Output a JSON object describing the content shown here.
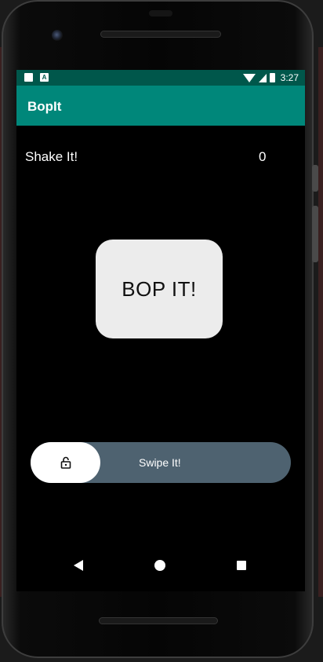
{
  "status_bar": {
    "time": "3:27",
    "icons": [
      "sd-card-icon",
      "a-notification-icon",
      "wifi-icon",
      "signal-icon",
      "battery-icon"
    ],
    "notification_a_letter": "A"
  },
  "app_bar": {
    "title": "BopIt",
    "color": "#00877a"
  },
  "game": {
    "instruction": "Shake It!",
    "score": "0"
  },
  "bop_button": {
    "label": "BOP IT!"
  },
  "swipe": {
    "label": "Swipe It!",
    "thumb_icon": "lock-icon",
    "track_color": "#4e6270"
  },
  "nav": {
    "icons": [
      "back-icon",
      "home-icon",
      "recents-icon"
    ]
  }
}
